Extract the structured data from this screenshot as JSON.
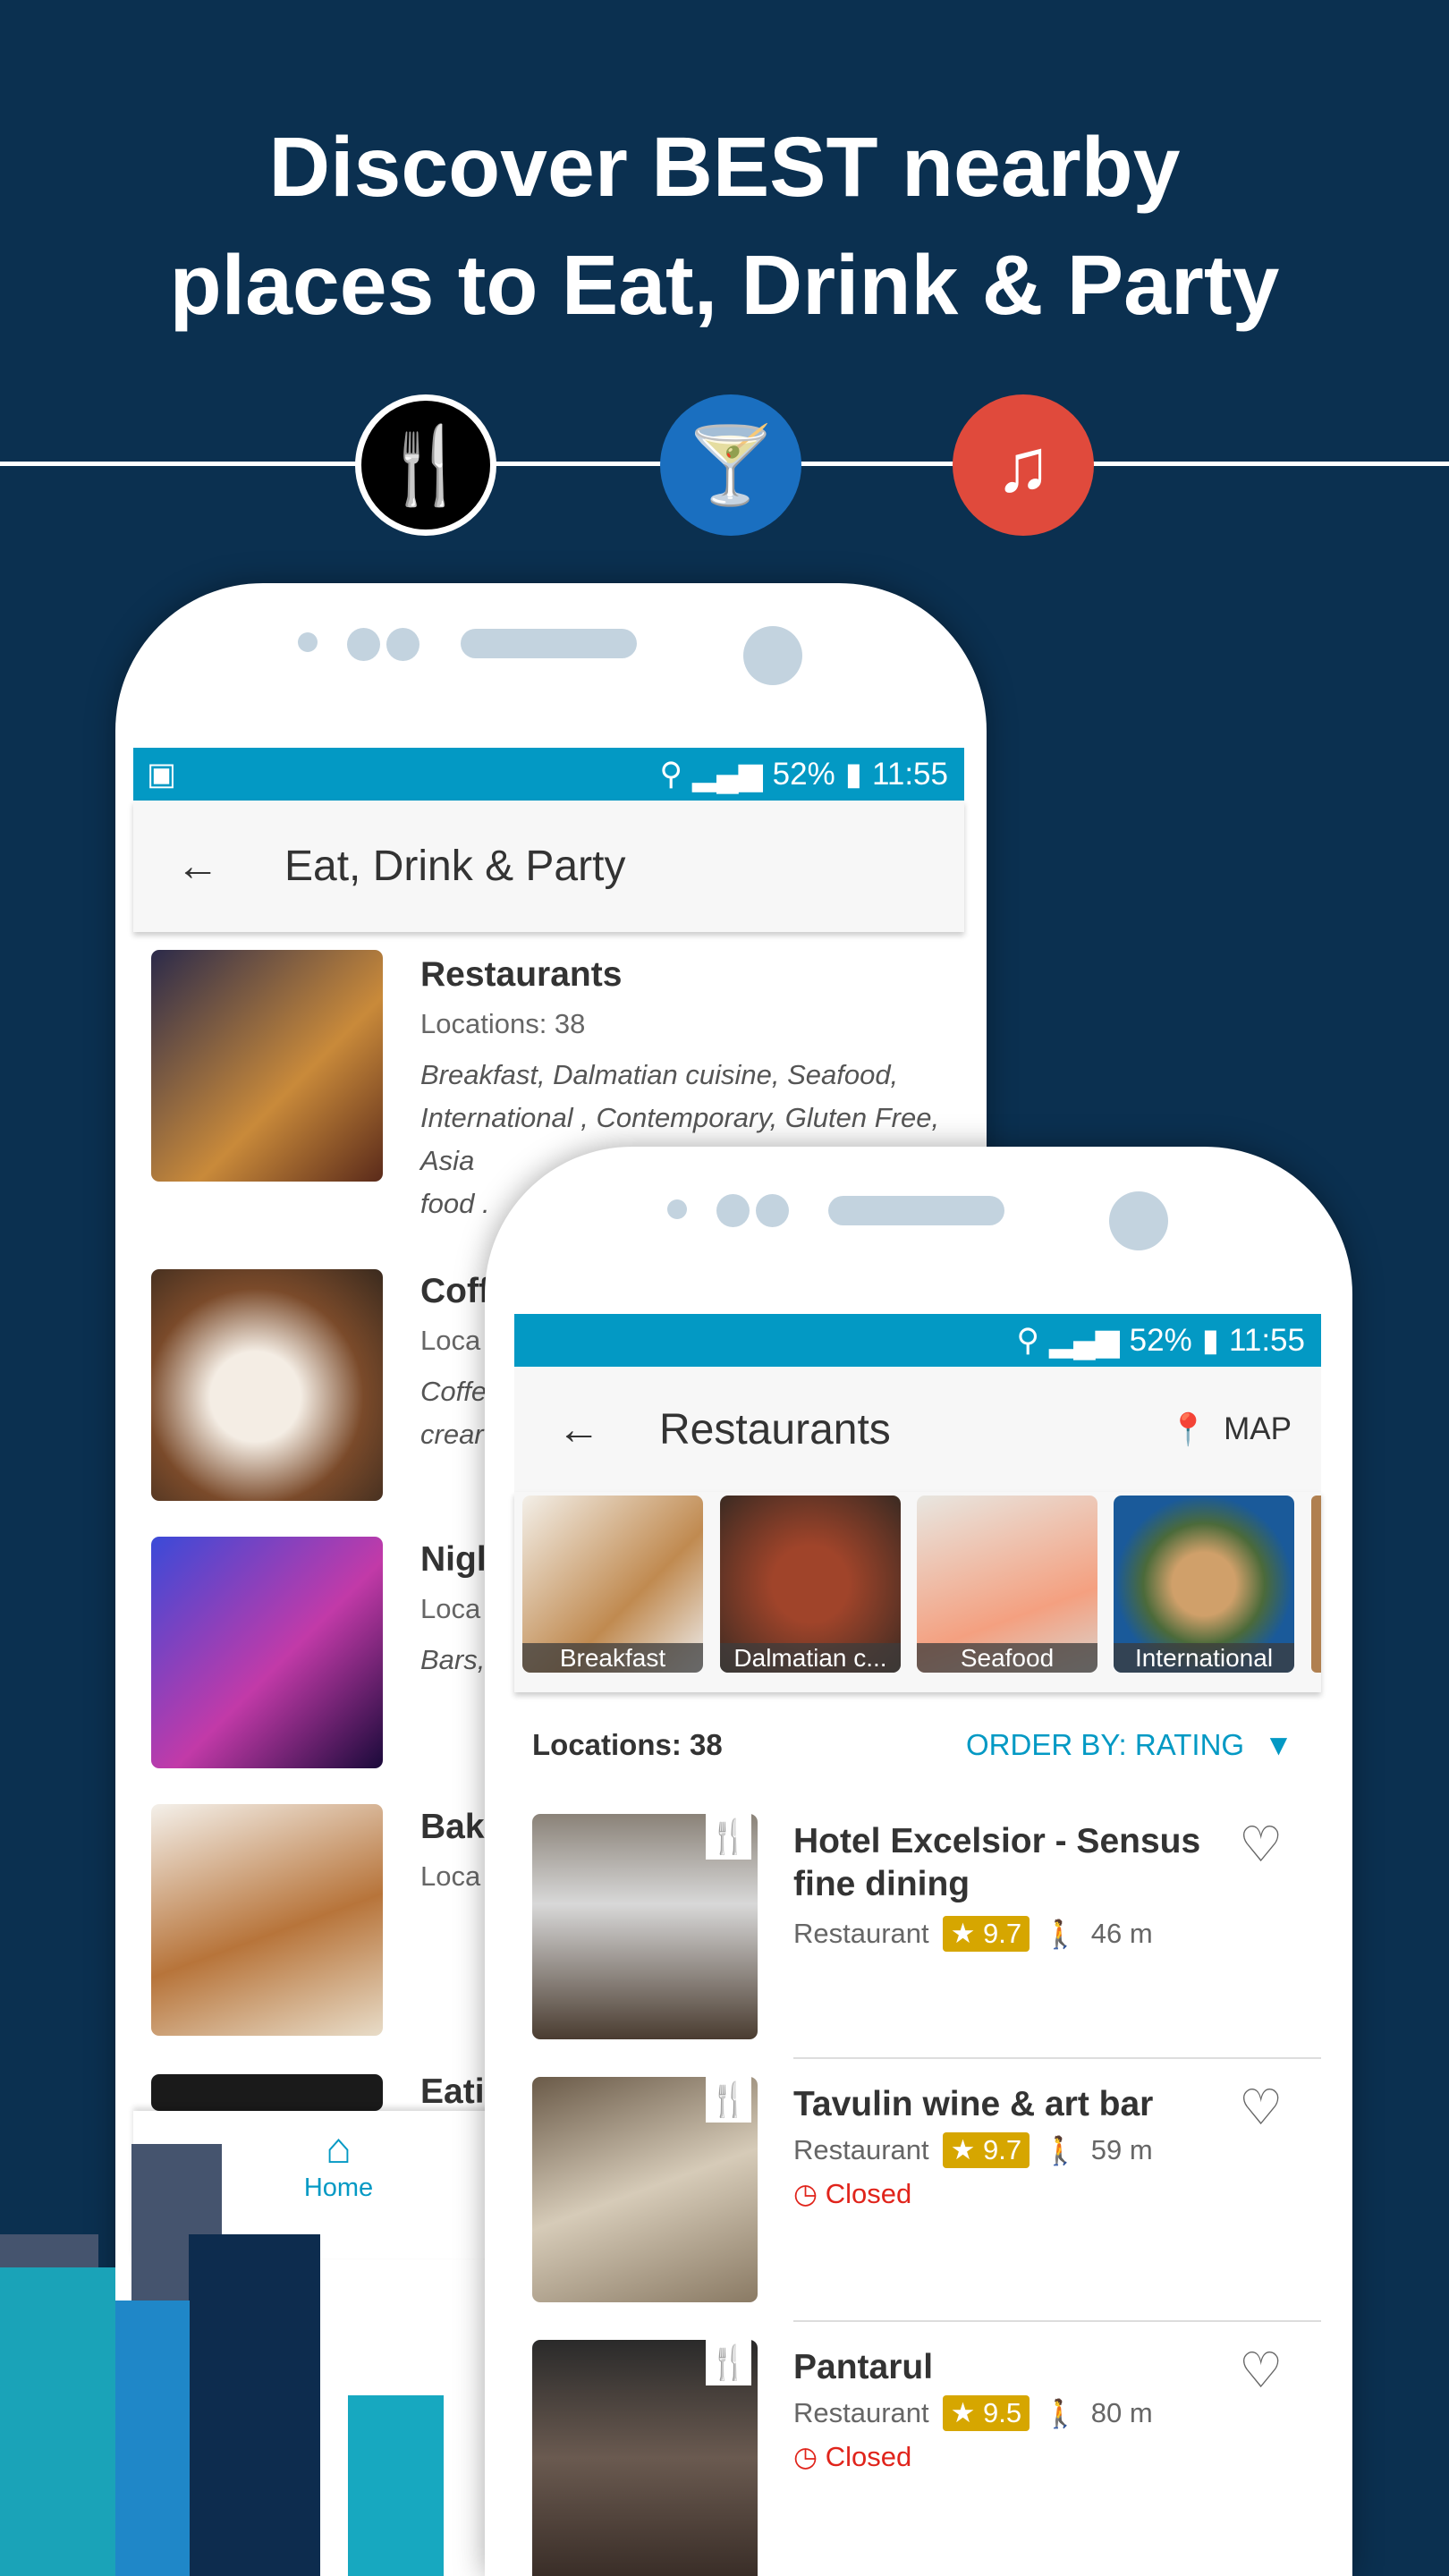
{
  "headline": {
    "line1": "Discover BEST nearby",
    "line2": "places to Eat, Drink & Party"
  },
  "icons": [
    {
      "name": "fork-spoon-icon",
      "color": "#000000"
    },
    {
      "name": "cocktail-icon",
      "color": "#1a6fc0"
    },
    {
      "name": "music-note-icon",
      "color": "#e04a3c"
    }
  ],
  "colors": {
    "background": "#0b3050",
    "status_bar": "#0399c4",
    "accent": "#0399c4",
    "rating": "#d6a600",
    "closed": "#e0241b"
  },
  "phone1": {
    "status": {
      "battery": "52%",
      "time": "11:55"
    },
    "title": "Eat, Drink & Party",
    "items": [
      {
        "title": "Restaurants",
        "locations": "Locations: 38",
        "tags": "Breakfast, Dalmatian cuisine, Seafood, International , Contemporary, Gluten Free, Asia",
        "tags2": "food ."
      },
      {
        "title": "Coff",
        "locations": "Loca",
        "tags": "Coffe",
        "tags2": "crear"
      },
      {
        "title": "Nigl",
        "locations": "Loca",
        "tags": "Bars,",
        "tags2": ""
      },
      {
        "title": "Bak",
        "locations": "Loca",
        "tags": "",
        "tags2": ""
      },
      {
        "title": "Eati",
        "locations": "",
        "tags": "",
        "tags2": ""
      }
    ],
    "nav": {
      "home": "Home"
    }
  },
  "phone2": {
    "status": {
      "battery": "52%",
      "time": "11:55"
    },
    "title": "Restaurants",
    "map": "MAP",
    "categories": [
      "Breakfast",
      "Dalmatian c...",
      "Seafood",
      "International"
    ],
    "locations": "Locations: 38",
    "order_by": "ORDER BY: RATING",
    "items": [
      {
        "name": "Hotel Excelsior - Sensus fine dining",
        "type": "Restaurant",
        "rating": "9.7",
        "distance": "46 m",
        "status": ""
      },
      {
        "name": "Tavulin wine & art bar",
        "type": "Restaurant",
        "rating": "9.7",
        "distance": "59 m",
        "status": "Closed"
      },
      {
        "name": "Pantarul",
        "type": "Restaurant",
        "rating": "9.5",
        "distance": "80 m",
        "status": "Closed"
      }
    ]
  }
}
